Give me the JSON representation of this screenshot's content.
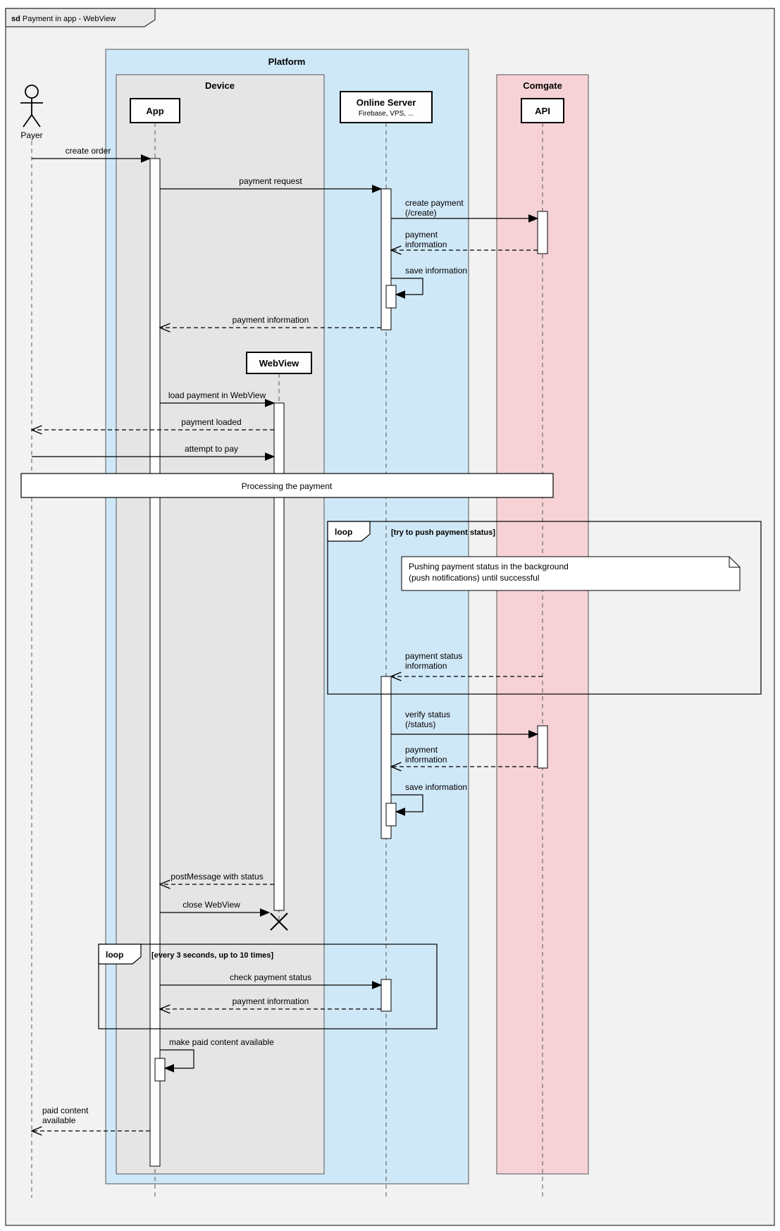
{
  "frame": {
    "sd_label": "sd",
    "title": "Payment in app - WebView"
  },
  "boxes": {
    "platform": "Platform",
    "device": "Device",
    "comgate": "Comgate"
  },
  "participants": {
    "payer": "Payer",
    "app": "App",
    "webview": "WebView",
    "server": {
      "title": "Online Server",
      "subtitle": "Firebase, VPS, ..."
    },
    "api": "API"
  },
  "messages": {
    "create_order": "create order",
    "payment_request": "payment request",
    "create_payment": "create payment\n(/create)",
    "payment_information_1": "payment\ninformation",
    "save_information_1": "save information",
    "payment_information_2": "payment information",
    "load_payment": "load payment in WebView",
    "payment_loaded": "payment loaded",
    "attempt_to_pay": "attempt to pay",
    "processing_ref": "Processing the payment",
    "loop1_guard": "[try to push payment status]",
    "push_note": "Pushing payment status in the background\n(push notifications) until successful",
    "payment_status_info": "payment status\ninformation",
    "verify_status": "verify status\n(/status)",
    "payment_information_3": "payment\ninformation",
    "save_information_2": "save information",
    "post_message": "postMessage with status",
    "close_webview": "close WebView",
    "loop2_guard": "[every 3 seconds, up to 10 times]",
    "check_payment_status": "check payment status",
    "payment_information_4": "payment information",
    "make_paid_content": "make paid content available",
    "paid_content_available": "paid content\navailable",
    "loop_label": "loop"
  }
}
